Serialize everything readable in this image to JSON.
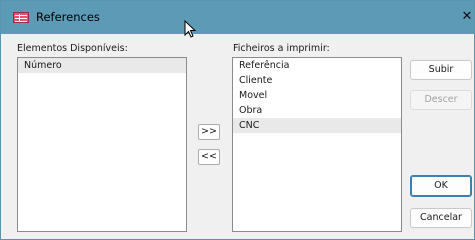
{
  "window": {
    "title": "References",
    "close_glyph": "✕",
    "accent": "#5d9ab6"
  },
  "available": {
    "label": "Elementos Disponíveis:",
    "items": [
      "Número"
    ]
  },
  "to_print": {
    "label": "Ficheiros a imprimir:",
    "items": [
      "Referência",
      "Cliente",
      "Movel",
      "Obra",
      "CNC"
    ],
    "selected": "CNC"
  },
  "buttons": {
    "add_all": ">>",
    "remove_all": "<<",
    "up": "Subir",
    "down": "Descer",
    "ok": "OK",
    "cancel": "Cancelar"
  },
  "icons": [
    "table-icon",
    "close-icon",
    "mouse-cursor-icon"
  ]
}
